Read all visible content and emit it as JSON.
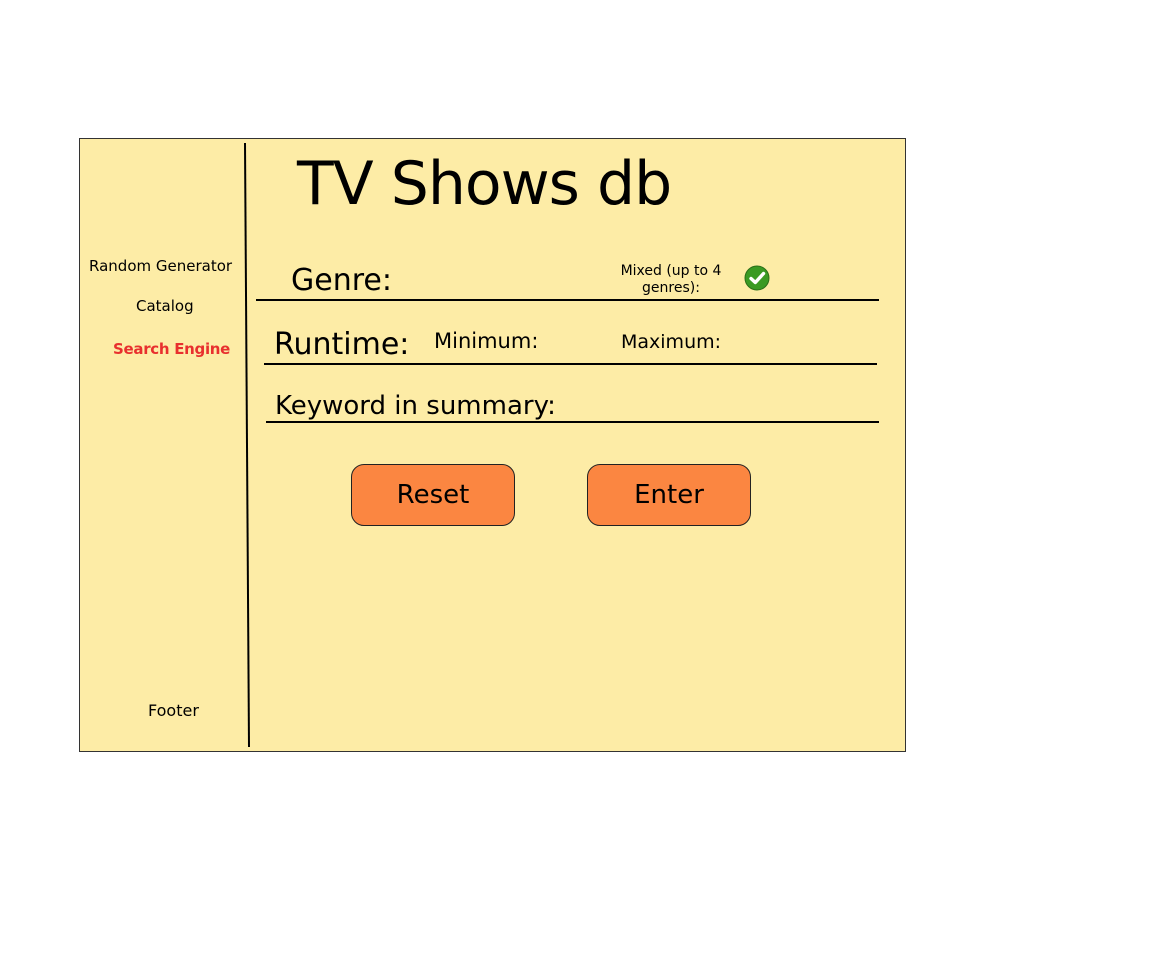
{
  "app": {
    "title": "TV Shows db"
  },
  "sidebar": {
    "items": [
      {
        "label": "Random Generator",
        "active": false
      },
      {
        "label": "Catalog",
        "active": false
      },
      {
        "label": "Search Engine",
        "active": true
      }
    ],
    "footer": "Footer"
  },
  "form": {
    "genre_label": "Genre:",
    "mixed_label": "Mixed (up to 4 genres):",
    "mixed_checked": true,
    "runtime_label": "Runtime:",
    "minimum_label": "Minimum:",
    "maximum_label": "Maximum:",
    "keyword_label": "Keyword in summary:"
  },
  "buttons": {
    "reset": "Reset",
    "enter": "Enter"
  },
  "colors": {
    "background": "#fdeca6",
    "active_nav": "#e8302e",
    "button": "#fb8641",
    "check": "#3a9a23"
  },
  "icons": {
    "mixed_toggle": "green-checkmark-icon"
  }
}
